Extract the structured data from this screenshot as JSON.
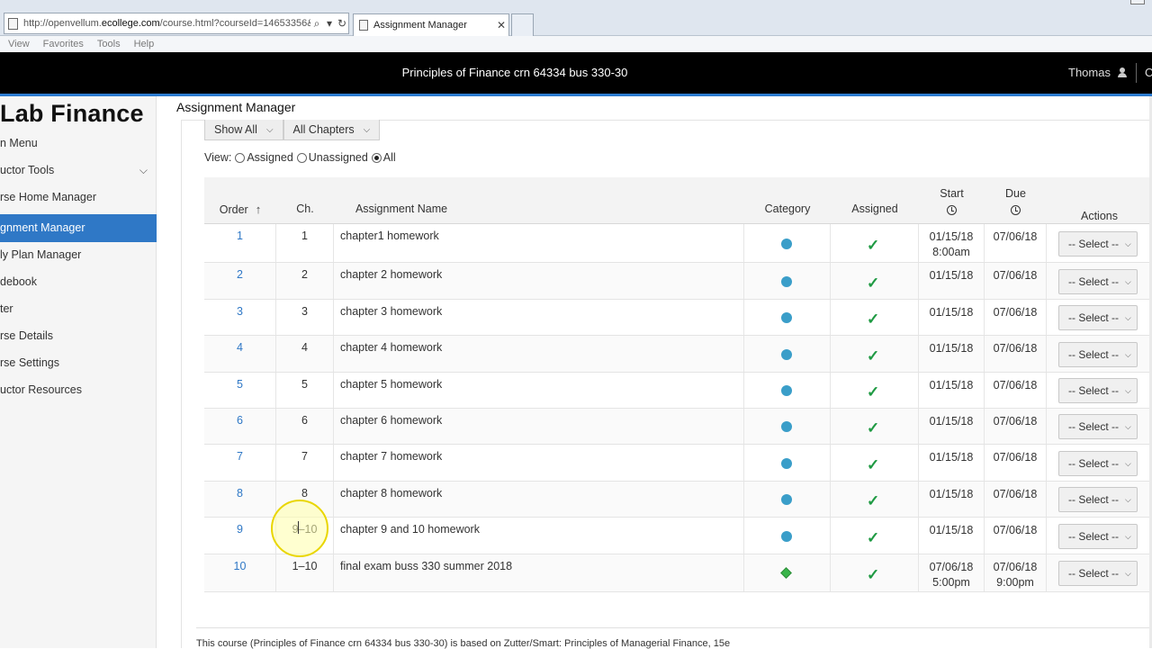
{
  "browser": {
    "url_prefix": "http://openvellum.",
    "url_domain": "ecollege.com",
    "url_suffix": "/course.html?courseId=14653356&",
    "tab_title": "Assignment Manager",
    "menu": [
      "View",
      "Favorites",
      "Tools",
      "Help"
    ]
  },
  "header": {
    "course_title": "Principles of Finance crn 64334 bus 330-30",
    "user_name": "Thomas",
    "cut_text": "C"
  },
  "sidebar": {
    "brand": "Lab Finance",
    "items": [
      {
        "label": "n Menu"
      },
      {
        "label": "uctor Tools"
      },
      {
        "label": "rse Home Manager"
      },
      {
        "label": "gnment Manager"
      },
      {
        "label": "ly Plan Manager"
      },
      {
        "label": "debook"
      },
      {
        "label": "ter"
      },
      {
        "label": "rse Details"
      },
      {
        "label": "rse Settings"
      },
      {
        "label": "uctor Resources"
      }
    ]
  },
  "main": {
    "title": "Assignment Manager",
    "filters": {
      "show": "Show All",
      "chapters": "All Chapters"
    },
    "view": {
      "label": "View:",
      "assigned": "Assigned",
      "unassigned": "Unassigned",
      "all": "All",
      "selected": "All"
    },
    "columns": {
      "order": "Order",
      "ch": "Ch.",
      "name": "Assignment Name",
      "category": "Category",
      "assigned": "Assigned",
      "start": "Start",
      "due": "Due",
      "actions": "Actions"
    },
    "rows": [
      {
        "order": "1",
        "ch": "1",
        "name": "chapter1 homework",
        "category": "homework",
        "assigned": true,
        "start": "01/15/18",
        "start_time": "8:00am",
        "due": "07/06/18",
        "due_time": "",
        "action": "-- Select --"
      },
      {
        "order": "2",
        "ch": "2",
        "name": "chapter 2 homework",
        "category": "homework",
        "assigned": true,
        "start": "01/15/18",
        "start_time": "",
        "due": "07/06/18",
        "due_time": "",
        "action": "-- Select --"
      },
      {
        "order": "3",
        "ch": "3",
        "name": "chapter 3 homework",
        "category": "homework",
        "assigned": true,
        "start": "01/15/18",
        "start_time": "",
        "due": "07/06/18",
        "due_time": "",
        "action": "-- Select --"
      },
      {
        "order": "4",
        "ch": "4",
        "name": "chapter 4 homework",
        "category": "homework",
        "assigned": true,
        "start": "01/15/18",
        "start_time": "",
        "due": "07/06/18",
        "due_time": "",
        "action": "-- Select --"
      },
      {
        "order": "5",
        "ch": "5",
        "name": "chapter 5 homework",
        "category": "homework",
        "assigned": true,
        "start": "01/15/18",
        "start_time": "",
        "due": "07/06/18",
        "due_time": "",
        "action": "-- Select --"
      },
      {
        "order": "6",
        "ch": "6",
        "name": "chapter 6 homework",
        "category": "homework",
        "assigned": true,
        "start": "01/15/18",
        "start_time": "",
        "due": "07/06/18",
        "due_time": "",
        "action": "-- Select --"
      },
      {
        "order": "7",
        "ch": "7",
        "name": "chapter 7 homework",
        "category": "homework",
        "assigned": true,
        "start": "01/15/18",
        "start_time": "",
        "due": "07/06/18",
        "due_time": "",
        "action": "-- Select --"
      },
      {
        "order": "8",
        "ch": "8",
        "name": "chapter 8 homework",
        "category": "homework",
        "assigned": true,
        "start": "01/15/18",
        "start_time": "",
        "due": "07/06/18",
        "due_time": "",
        "action": "-- Select --"
      },
      {
        "order": "9",
        "ch": "9–10",
        "name": "chapter 9 and 10 homework",
        "category": "homework",
        "assigned": true,
        "start": "01/15/18",
        "start_time": "",
        "due": "07/06/18",
        "due_time": "",
        "action": "-- Select --"
      },
      {
        "order": "10",
        "ch": "1–10",
        "name": "final exam buss 330 summer 2018",
        "category": "test",
        "assigned": true,
        "start": "07/06/18",
        "start_time": "5:00pm",
        "due": "07/06/18",
        "due_time": "9:00pm",
        "action": "-- Select --"
      }
    ],
    "footer": "This course (Principles of Finance crn 64334 bus 330-30) is based on Zutter/Smart: Principles of Managerial Finance, 15e"
  },
  "colors": {
    "accent": "#2f78c6",
    "header_bg": "#000000",
    "check": "#1f9a43",
    "homework_dot": "#3a9ec9",
    "test_diamond": "#39b54a"
  }
}
